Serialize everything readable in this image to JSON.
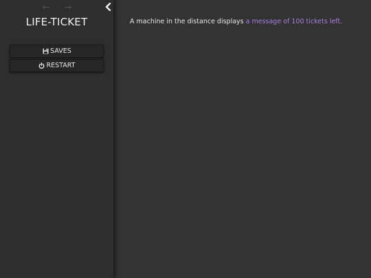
{
  "sidebar": {
    "nav": {
      "back_icon": "arrow-left-icon",
      "forward_icon": "arrow-right-icon",
      "stow_icon": "chevron-left-icon"
    },
    "story_title": "LIFE-TICKET",
    "menu": {
      "saves_label": "SAVES",
      "saves_icon": "floppy-disk-icon",
      "restart_label": "RESTART",
      "restart_icon": "power-icon"
    }
  },
  "passage": {
    "text_before": "A machine in the distance displays ",
    "link_text": "a message of 100 tickets left."
  },
  "colors": {
    "background": "#333333",
    "sidebar": "#2e2e2e",
    "link": "#a97fe0",
    "text": "#e8e8e8"
  }
}
